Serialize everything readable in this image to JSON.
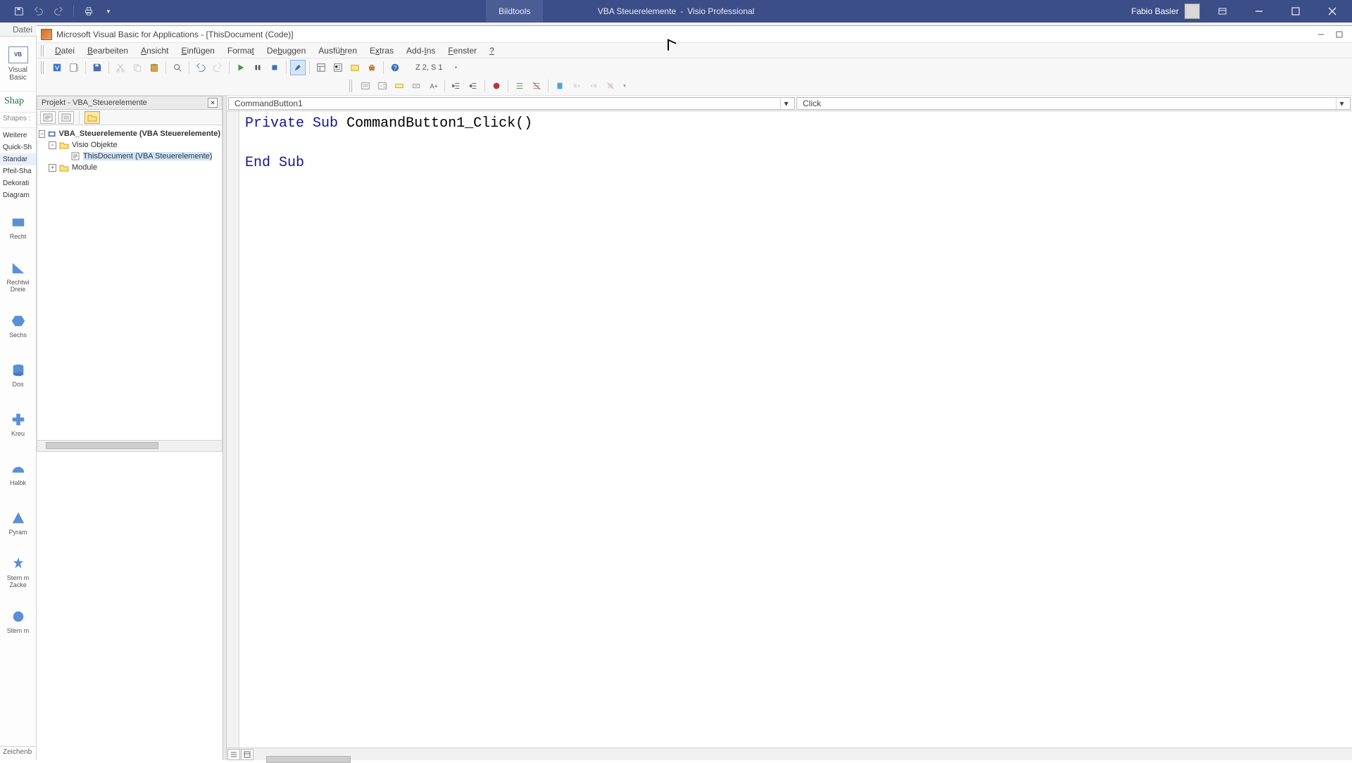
{
  "visio": {
    "tool_tab": "Bildtools",
    "doc_title": "VBA Steuerelemente",
    "app_suffix": "Visio Professional",
    "user": "Fabio Basler",
    "ribbon_tab": "Datei",
    "vb_label": "Visual\nBasic",
    "shapes_header": "Shap",
    "shapes_search": "Shapes :",
    "stencils": [
      "Weitere",
      "Quick-Sh",
      "Standar",
      "Pfeil-Sha",
      "Dekorati",
      "Diagram"
    ],
    "shape_items": [
      "Recht",
      "Rechtwi\nDreie",
      "Sechs",
      "Dos",
      "Kreu",
      "Halbk",
      "Pyram",
      "Stern m\nZacke",
      "Stern m"
    ],
    "bottom_tab": "Zeichenb"
  },
  "vba": {
    "window_title": "Microsoft Visual Basic for Applications - [ThisDocument (Code)]",
    "menus": [
      "Datei",
      "Bearbeiten",
      "Ansicht",
      "Einfügen",
      "Format",
      "Debuggen",
      "Ausführen",
      "Extras",
      "Add-Ins",
      "Fenster",
      "?"
    ],
    "position": "Z 2, S 1",
    "project": {
      "title": "Projekt - VBA_Steuerelemente",
      "root": "VBA_Steuerelemente (VBA Steuerelemente)",
      "visio_objects": "Visio Objekte",
      "this_doc": "ThisDocument (VBA Steuerelemente)",
      "modules": "Module"
    },
    "object_dd": "CommandButton1",
    "proc_dd": "Click",
    "code": {
      "l1a": "Private",
      "l1b": "Sub",
      "l1c": "CommandButton1_Click()",
      "l3a": "End",
      "l3b": "Sub"
    }
  }
}
